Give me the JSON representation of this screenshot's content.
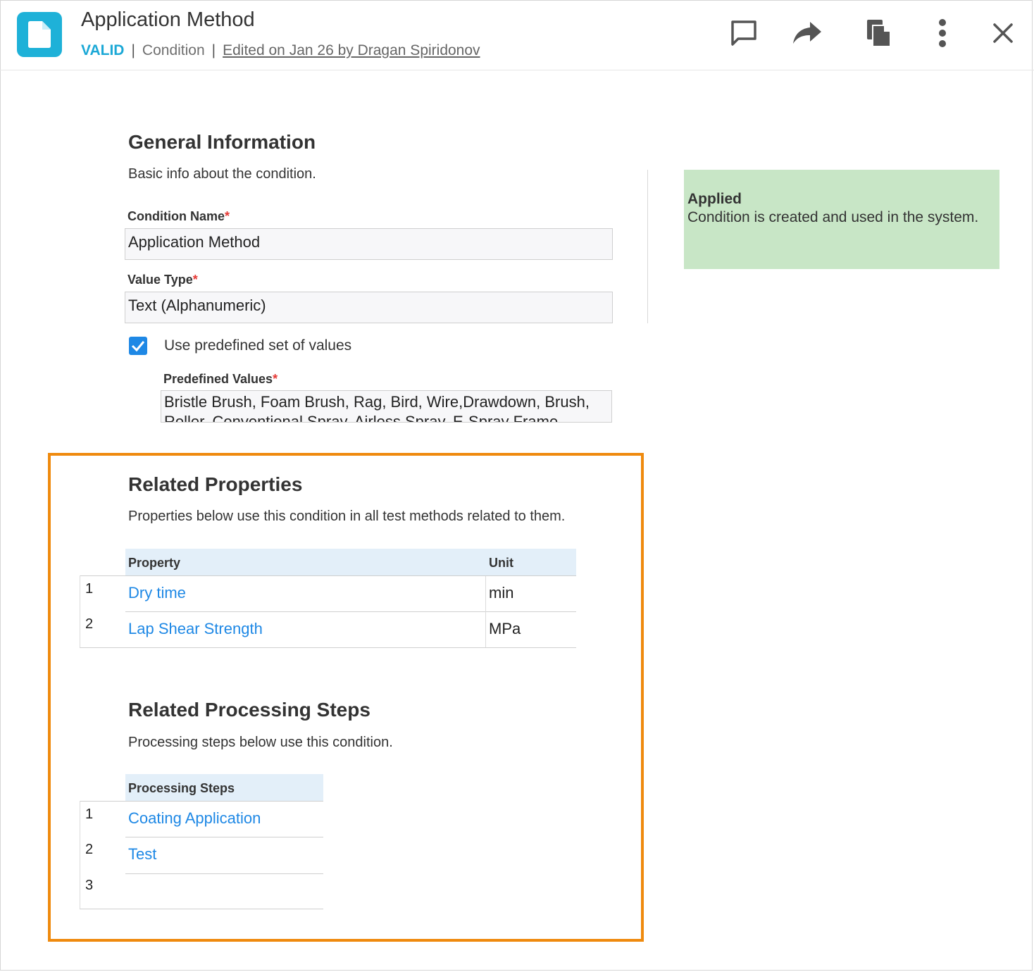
{
  "header": {
    "title": "Application Method",
    "status": "VALID",
    "type": "Condition",
    "edited": "Edited on Jan 26 by Dragan Spiridonov",
    "separator": "|"
  },
  "general": {
    "heading": "General Information",
    "description": "Basic info about the condition.",
    "condition_name_label": "Condition Name",
    "condition_name_value": "Application Method",
    "value_type_label": "Value Type",
    "value_type_value": "Text (Alphanumeric)",
    "checkbox_label": "Use predefined set of values",
    "checkbox_checked": true,
    "predefined_label": "Predefined Values",
    "predefined_line1": "Bristle Brush, Foam Brush, Rag, Bird, Wire,Drawdown, Brush,",
    "predefined_line2": "Roller, Conventional Spray, Airless Spray, E-Spray Frame",
    "required_mark": "*"
  },
  "status_panel": {
    "title": "Applied",
    "text": "Condition is created and used in the system.",
    "color": "#c8e6c6"
  },
  "related_properties": {
    "heading": "Related Properties",
    "description": "Properties below use this condition in all test methods related to them.",
    "columns": [
      "Property",
      "Unit"
    ],
    "rows": [
      {
        "num": "1",
        "property": "Dry time",
        "unit": "min"
      },
      {
        "num": "2",
        "property": "Lap Shear Strength",
        "unit": "MPa"
      }
    ]
  },
  "related_steps": {
    "heading": "Related Processing Steps",
    "description": "Processing steps below use this condition.",
    "column": "Processing Steps",
    "rows": [
      {
        "num": "1",
        "step": "Coating Application"
      },
      {
        "num": "2",
        "step": "Test"
      },
      {
        "num": "3",
        "step": ""
      }
    ]
  },
  "toolbar": {
    "icons": [
      "comment-icon",
      "share-icon",
      "copy-icon",
      "more-vertical-icon",
      "close-icon"
    ]
  },
  "colors": {
    "accent": "#1eb1d8",
    "link": "#1e88e5",
    "highlight_border": "#ef8a0e",
    "table_header": "#e3eff9"
  }
}
